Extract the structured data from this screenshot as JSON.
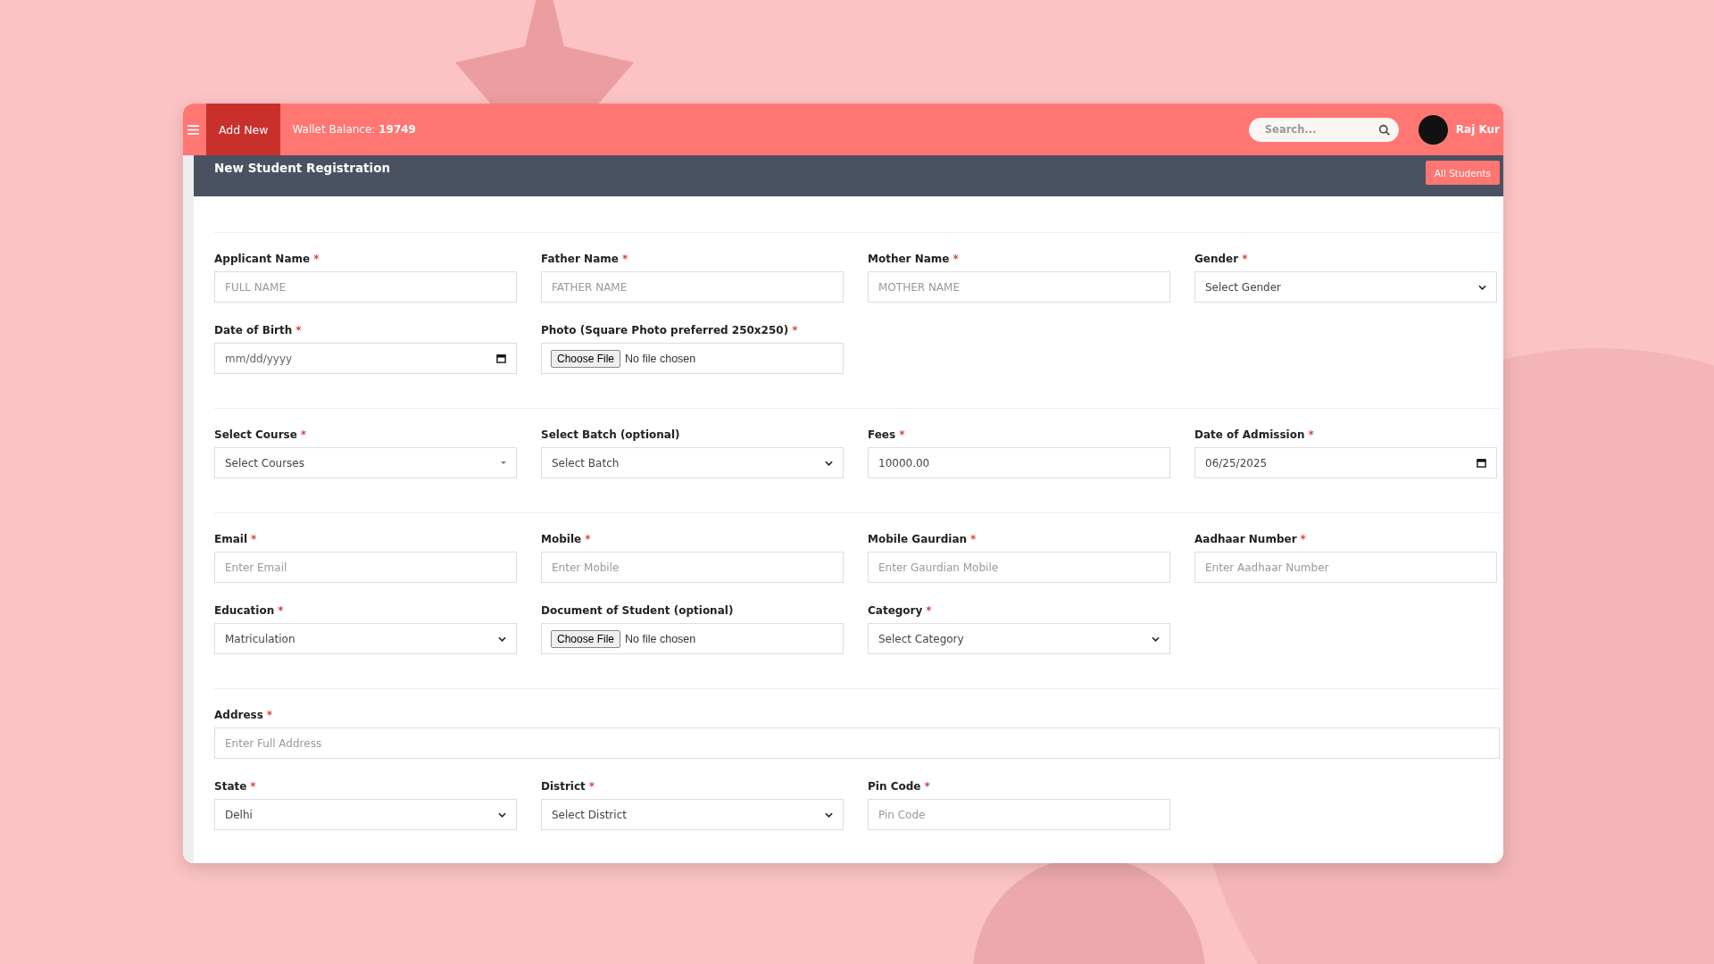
{
  "header": {
    "add_button": "Add New",
    "wallet_label": "Wallet Balance:",
    "wallet_value": "19749",
    "search": {
      "placeholder": "Search..."
    },
    "user_name": "Raj Kur"
  },
  "title_bar": {
    "title": "New Student Registration",
    "button": "All Students"
  },
  "sections": [
    {
      "rows": [
        [
          {
            "kind": "text",
            "label": "Applicant Name",
            "mark": "*",
            "placeholder": "FULL NAME"
          },
          {
            "kind": "text",
            "label": "Father Name",
            "mark": "*",
            "placeholder": "FATHER NAME"
          },
          {
            "kind": "text",
            "label": "Mother Name",
            "mark": "*",
            "placeholder": "MOTHER NAME"
          },
          {
            "kind": "select",
            "label": "Gender",
            "mark": "*",
            "value": "Select Gender"
          }
        ],
        [
          {
            "kind": "date",
            "label": "Date of Birth",
            "mark": "*",
            "placeholder": "mm/dd/yyyy"
          },
          {
            "kind": "file",
            "label": "Photo (Square Photo preferred 250x250)",
            "mark": "*",
            "button": "Choose File",
            "value": "No file chosen"
          }
        ]
      ]
    },
    {
      "rows": [
        [
          {
            "kind": "combo",
            "label": "Select Course",
            "mark": "*",
            "value": "Select Courses"
          },
          {
            "kind": "select",
            "label": "Select Batch (optional)",
            "value": "Select Batch"
          },
          {
            "kind": "text",
            "label": "Fees",
            "mark": "*",
            "value": "10000.00"
          },
          {
            "kind": "date",
            "label": "Date of Admission",
            "mark": "*",
            "value": "06/25/2025"
          }
        ]
      ]
    },
    {
      "rows": [
        [
          {
            "kind": "text",
            "label": "Email",
            "mark": "*",
            "placeholder": "Enter Email"
          },
          {
            "kind": "text",
            "label": "Mobile",
            "mark": "*",
            "placeholder": "Enter Mobile"
          },
          {
            "kind": "text",
            "label": "Mobile Gaurdian",
            "mark": "*",
            "placeholder": "Enter Gaurdian Mobile"
          },
          {
            "kind": "text",
            "label": "Aadhaar Number",
            "mark": "*",
            "placeholder": "Enter Aadhaar Number"
          }
        ],
        [
          {
            "kind": "select",
            "label": "Education",
            "mark": "*",
            "value": "Matriculation"
          },
          {
            "kind": "file",
            "label": "Document of Student (optional)",
            "button": "Choose File",
            "value": "No file chosen"
          },
          {
            "kind": "select",
            "label": "Category",
            "mark": "*",
            "value": "Select Category"
          }
        ]
      ]
    },
    {
      "rows": [
        [
          {
            "kind": "wide",
            "label": "Address",
            "mark": "*",
            "placeholder": "Enter Full Address"
          }
        ],
        [
          {
            "kind": "select",
            "label": "State",
            "mark": "*",
            "value": "Delhi"
          },
          {
            "kind": "select",
            "label": "District",
            "mark": "*",
            "value": "Select District"
          },
          {
            "kind": "text",
            "label": "Pin Code",
            "mark": "*",
            "placeholder": "Pin Code"
          }
        ]
      ]
    }
  ]
}
